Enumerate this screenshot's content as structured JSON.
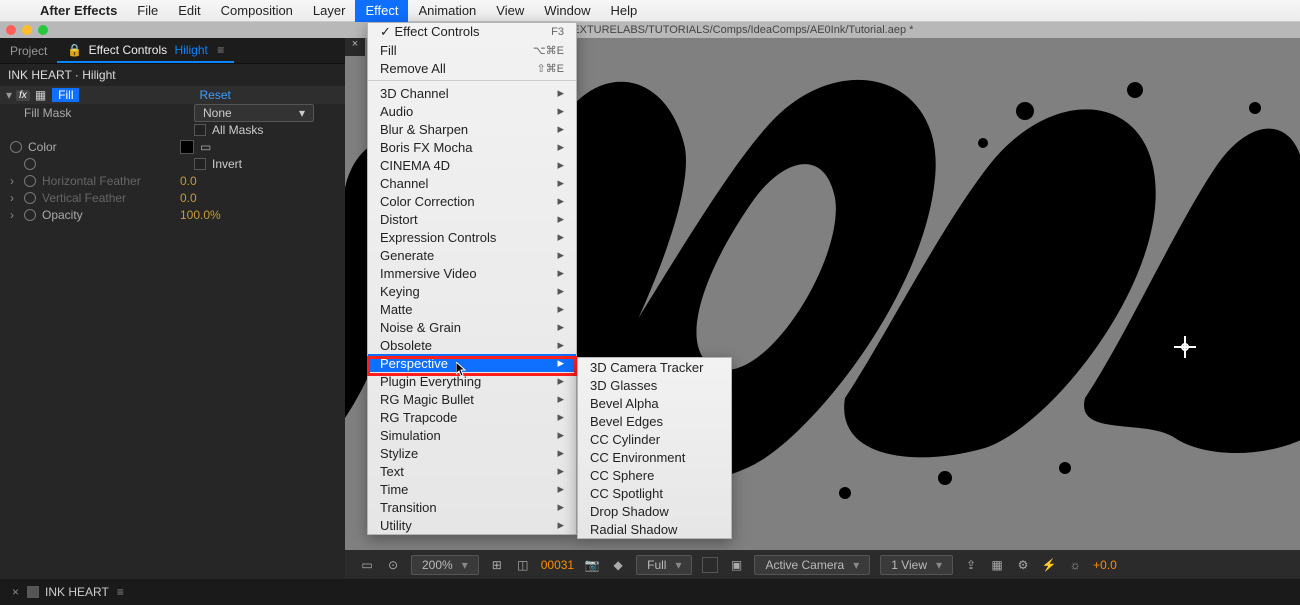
{
  "menubar": {
    "app": "After Effects",
    "items": [
      "File",
      "Edit",
      "Composition",
      "Layer",
      "Effect",
      "Animation",
      "View",
      "Window",
      "Help"
    ],
    "selected_index": 4
  },
  "window_path": "sers/be/Documents/PROJECTS/TEXTURELABS/TUTORIALS/Comps/IdeaComps/AE0Ink/Tutorial.aep *",
  "project_tab": "Project",
  "effect_controls_tab": "Effect Controls",
  "effect_controls_layer": "Hilight",
  "layer_path": "INK HEART · Hilight",
  "fx": {
    "name": "Fill",
    "reset": "Reset",
    "mask_label": "Fill Mask",
    "mask_value": "None",
    "all_masks": "All Masks",
    "color": "Color",
    "invert": "Invert",
    "hfeather": "Horizontal Feather",
    "hfeather_val": "0.0",
    "vfeather": "Vertical Feather",
    "vfeather_val": "0.0",
    "opacity": "Opacity",
    "opacity_val": "100.0%"
  },
  "effect_menu": {
    "effect_controls": "Effect Controls",
    "effect_controls_sc": "F3",
    "fill": "Fill",
    "fill_sc": "⌥⌘E",
    "remove_all": "Remove All",
    "remove_all_sc": "⇧⌘E",
    "categories": [
      "3D Channel",
      "Audio",
      "Blur & Sharpen",
      "Boris FX Mocha",
      "CINEMA 4D",
      "Channel",
      "Color Correction",
      "Distort",
      "Expression Controls",
      "Generate",
      "Immersive Video",
      "Keying",
      "Matte",
      "Noise & Grain",
      "Obsolete",
      "Perspective",
      "Plugin Everything",
      "RG Magic Bullet",
      "RG Trapcode",
      "Simulation",
      "Stylize",
      "Text",
      "Time",
      "Transition",
      "Utility"
    ],
    "highlighted": "Perspective"
  },
  "perspective_submenu": [
    "3D Camera Tracker",
    "3D Glasses",
    "Bevel Alpha",
    "Bevel Edges",
    "CC Cylinder",
    "CC Environment",
    "CC Sphere",
    "CC Spotlight",
    "Drop Shadow",
    "Radial Shadow"
  ],
  "viewer": {
    "zoom": "200%",
    "frame": "00031",
    "quality": "Full",
    "camera": "Active Camera",
    "views": "1 View",
    "exposure": "+0.0"
  },
  "bottom_tab": "INK HEART"
}
